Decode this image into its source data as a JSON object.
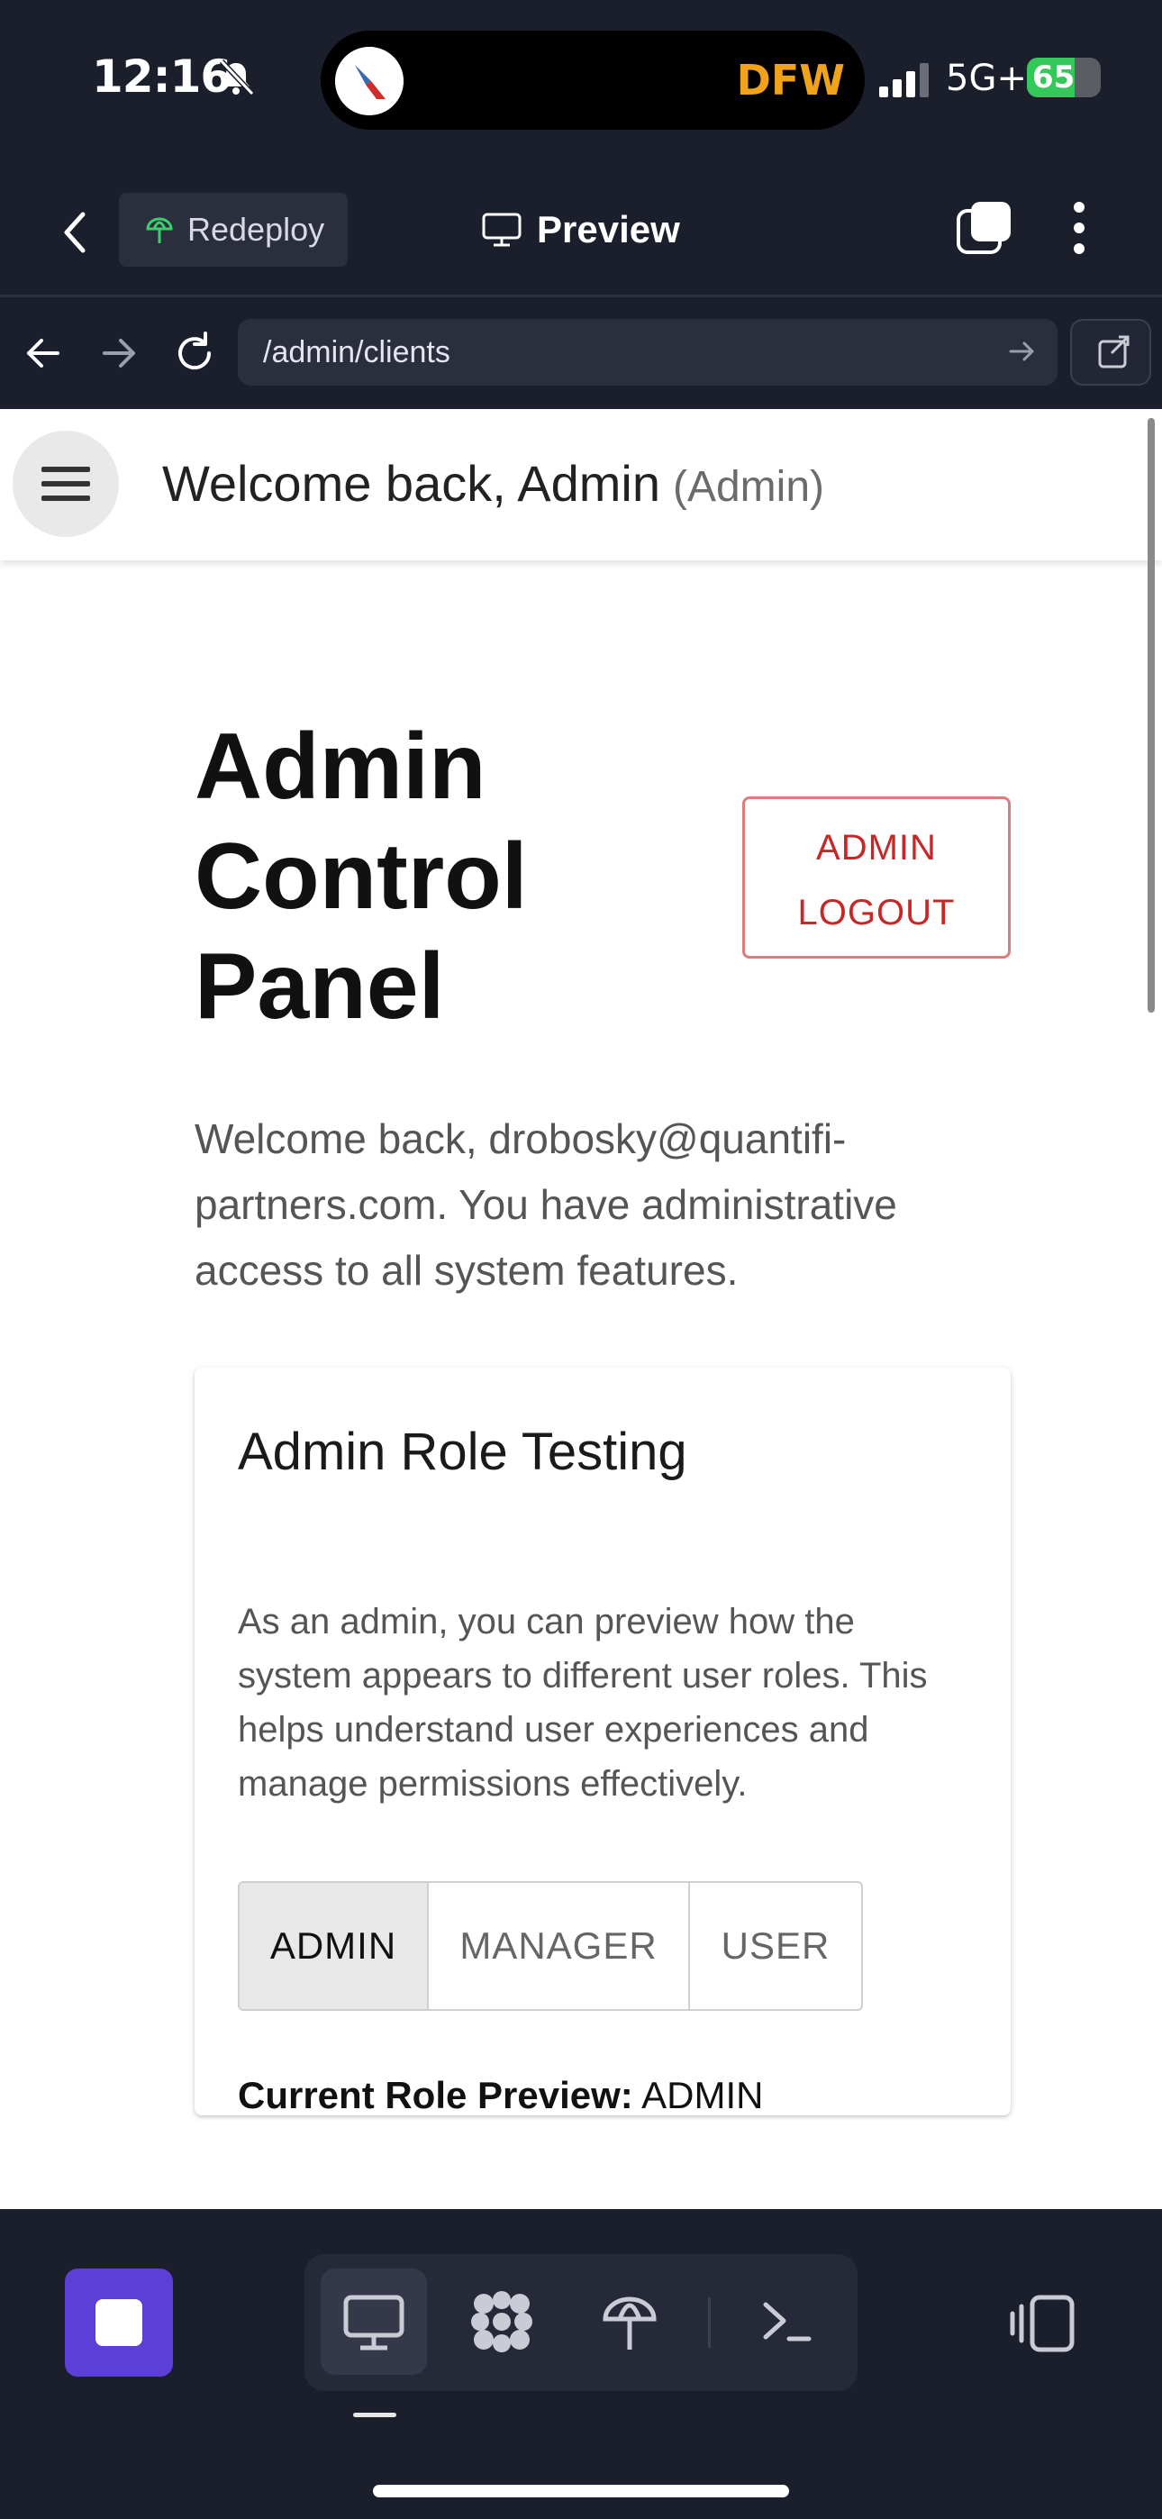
{
  "status_bar": {
    "time": "12:16",
    "location": "DFW",
    "network": "5G+",
    "battery": "65",
    "battery_level": 0.65
  },
  "app_header": {
    "redeploy_label": "Redeploy",
    "preview_label": "Preview"
  },
  "url_bar": {
    "url": "/admin/clients"
  },
  "page": {
    "topbar": {
      "welcome": "Welcome back, Admin",
      "role": "(Admin)"
    },
    "title": "Admin Control Panel",
    "logout_line1": "ADMIN",
    "logout_line2": "LOGOUT",
    "intro": "Welcome back, drobosky@quantifi-partners.com. You have administrative access to all system features.",
    "card": {
      "title": "Admin Role Testing",
      "text": "As an admin, you can preview how the system appears to different user roles. This helps understand user experiences and manage permissions effectively.",
      "roles": [
        "ADMIN",
        "MANAGER",
        "USER"
      ],
      "selected_role": "ADMIN",
      "current_label": "Current Role Preview:",
      "current_value": "ADMIN"
    }
  },
  "colors": {
    "chrome_bg": "#1b1e2b",
    "accent": "#5b3fd6",
    "danger": "#c62828",
    "location": "#f0a21b",
    "battery": "#34c759"
  },
  "icons": {
    "status": [
      "bell-slash-icon",
      "american-airlines-logo",
      "signal-icon",
      "battery-icon"
    ],
    "header": [
      "chevron-left-icon",
      "redeploy-icon",
      "monitor-icon",
      "tabs-icon",
      "more-vertical-icon"
    ],
    "url": [
      "arrow-left-icon",
      "arrow-right-icon",
      "reload-icon",
      "arrow-go-icon",
      "external-link-icon"
    ],
    "toolbar": [
      "stop-icon",
      "monitor-icon",
      "apps-grid-icon",
      "deploy-icon",
      "terminal-icon",
      "layout-icon"
    ]
  }
}
